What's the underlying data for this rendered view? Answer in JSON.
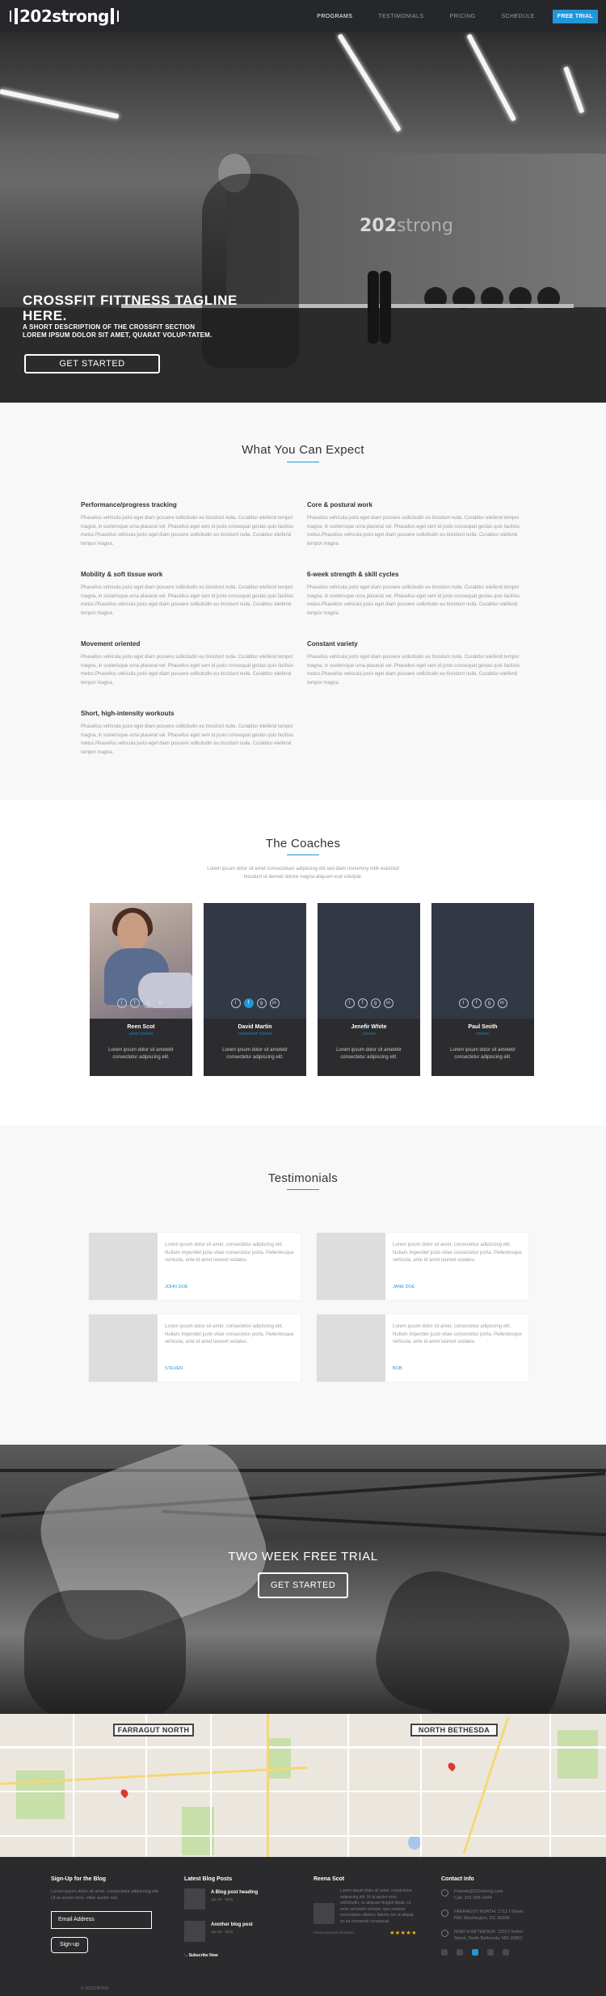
{
  "nav": {
    "logo": "202strong",
    "links": [
      "PROGRAMS",
      "TESTIMONIALS",
      "PRICING",
      "SCHEDULE"
    ],
    "cta": "FREE TRIAL"
  },
  "hero": {
    "title": "CROSSFIT FITTNESS TAGLINE HERE.",
    "subtitle": "A SHORT DESCRIPTION OF THE CROSSFIT SECTION LOREM IPSUM DOLOR SIT AMET, QUARAT VOLUP-TATEM.",
    "cta": "GET STARTED",
    "wall_logo_a": "202",
    "wall_logo_b": "strong"
  },
  "expect": {
    "title": "What You Can Expect",
    "features": [
      {
        "title": "Performance/progress tracking",
        "text": "Phasellus vehicula justo eget diam posuere sollicitudin eu tincidunt nulla. Curabitur eleifend tempor magna, in scelerisque urna placerat vel. Phasellus eget sem id justo consequat gestas quis facilisis metus.Phasellus vehicula justo eget diam posuere sollicitudin eu tincidunt nulla. Curabitur eleifend tempor magna."
      },
      {
        "title": "Core & postural work",
        "text": "Phasellus vehicula justo eget diam posuere sollicitudin eu tincidunt nulla. Curabitur eleifend tempor magna, in scelerisque urna placerat vel. Phasellus eget sem id justo consequat gestas quis facilisis metus.Phasellus vehicula justo eget diam posuere sollicitudin eu tincidunt nulla. Curabitur eleifend tempor magna."
      },
      {
        "title": "Mobility & soft tissue work",
        "text": "Phasellus vehicula justo eget diam posuere sollicitudin eu tincidunt nulla. Curabitur eleifend tempor magna, in scelerisque urna placerat vel. Phasellus eget sem id justo consequat gestas quis facilisis metus.Phasellus vehicula justo eget diam posuere sollicitudin eu tincidunt nulla. Curabitur eleifend tempor magna."
      },
      {
        "title": "6-week strength & skill cycles",
        "text": "Phasellus vehicula justo eget diam posuere sollicitudin eu tincidunt nulla. Curabitur eleifend tempor magna, in scelerisque urna placerat vel. Phasellus eget sem id justo consequat gestas quis facilisis metus.Phasellus vehicula justo eget diam posuere sollicitudin eu tincidunt nulla. Curabitur eleifend tempor magna."
      },
      {
        "title": "Movement oriented",
        "text": "Phasellus vehicula justo eget diam posuere sollicitudin eu tincidunt nulla. Curabitur eleifend tempor magna, in scelerisque urna placerat vel. Phasellus eget sem id justo consequat gestas quis facilisis metus.Phasellus vehicula justo eget diam posuere sollicitudin eu tincidunt nulla. Curabitur eleifend tempor magna."
      },
      {
        "title": "Constant variety",
        "text": "Phasellus vehicula justo eget diam posuere sollicitudin eu tincidunt nulla. Curabitur eleifend tempor magna, in scelerisque urna placerat vel. Phasellus eget sem id justo consequat gestas quis facilisis metus.Phasellus vehicula justo eget diam posuere sollicitudin eu tincidunt nulla. Curabitur eleifend tempor magna."
      },
      {
        "title": "Short, high-intensity workouts",
        "text": "Phasellus vehicula justo eget diam posuere sollicitudin eu tincidunt nulla. Curabitur eleifend tempor magna, in scelerisque urna placerat vel. Phasellus eget sem id justo consequat gestas quis facilisis metus.Phasellus vehicula justo eget diam posuere sollicitudin eu tincidunt nulla. Curabitur eleifend tempor magna."
      }
    ]
  },
  "coaches": {
    "title": "The Coaches",
    "intro": "Lorem ipsum dolor sit amet consectetuer adipiscing elit sed diam nonummy nibh euismod tincidunt ut laoreet dolore magna aliquam erat volutpat.",
    "cards": [
      {
        "name": "Reen Scot",
        "role": "LEAD COACH",
        "bio": "Lorem ipsum dolor sit ametetir consectetur adipiscing elit."
      },
      {
        "name": "David Martin",
        "role": "ASSISTANT COACH",
        "bio": "Lorem ipsum dolor sit ametetir consectetur adipiscing elit."
      },
      {
        "name": "Jenefir White",
        "role": "COACH",
        "bio": "Lorem ipsum dolor sit ametetir consectetur adipiscing elit."
      },
      {
        "name": "Paul Smith",
        "role": "COACH",
        "bio": "Lorem ipsum dolor sit ametetir consectetur adipiscing elit."
      }
    ],
    "social_icons": [
      "twitter-icon",
      "facebook-icon",
      "google-plus-icon",
      "linkedin-icon"
    ]
  },
  "testimonials": {
    "title": "Testimonials",
    "items": [
      {
        "text": "Lorem ipsum dolor sit amet, consectetur adipiscing elit. Nullam imperdiet justo vitae consectetur porta. Pellentesque vehicula, ante id amet laoreet sodales.",
        "name": "JOHN DOE"
      },
      {
        "text": "Lorem ipsum dolor sit amet, consectetur adipiscing elit. Nullam imperdiet justo vitae consectetur porta. Pellentesque vehicula, ante id amet laoreet sodales.",
        "name": "JANE DOE"
      },
      {
        "text": "Lorem ipsum dolor sit amet, consectetur adipiscing elit. Nullam imperdiet justo vitae consectetur porta. Pellentesque vehicula, ante id amet laoreet sodales.",
        "name": "STEVEN"
      },
      {
        "text": "Lorem ipsum dolor sit amet, consectetur adipiscing elit. Nullam imperdiet justo vitae consectetur porta. Pellentesque vehicula, ante id amet laoreet sodales.",
        "name": "BOB"
      }
    ]
  },
  "trial": {
    "title": "TWO WEEK FREE TRIAL",
    "cta": "GET STARTED"
  },
  "map": {
    "labels": [
      "FARRAGUT NORTH",
      "NORTH BETHESDA"
    ]
  },
  "footer": {
    "signup": {
      "heading": "Sign-Up for the Blog",
      "text": "Lorem ipsum dolor sit amet, consectetur adipiscing elit. Ut at auctor eros, vitae auctor nisl.",
      "placeholder": "Email Address",
      "button": "Sign-up"
    },
    "posts": {
      "heading": "Latest Blog Posts",
      "items": [
        {
          "title": "A Blog post heading",
          "date": "Apr 20 · 2015"
        },
        {
          "title": "Another blog post",
          "date": "Apr 18 · 2015"
        }
      ],
      "link_arrow": "⤿",
      "link": "Subscribe Now"
    },
    "review": {
      "heading": "Reena Scot",
      "text": "Lorem ipsum dolor sit amet, consectetur adipiscing elit. Ut at auctor eros sollicitudin, ac aliquam feugiat ligula. Ut enim ad minim veniam, quis nostrud exercitation ullamco laboris nisi ut aliquip ex ea commodo consequat.",
      "source": "FROM GOOGLE REVIEWS",
      "stars": "★★★★★"
    },
    "contact": {
      "heading": "Contact Info",
      "items": [
        "Friends@202strong.com\nCall: 301-396-1444",
        "FARRAGUT NORTH: 1712 I Street\nNW, Washington, DC 20006",
        "NORTH BETHESDA: 12017 Nebel\nStreet, North Bethesda, MD 20852"
      ]
    },
    "copyright": "© 202STRONG"
  }
}
